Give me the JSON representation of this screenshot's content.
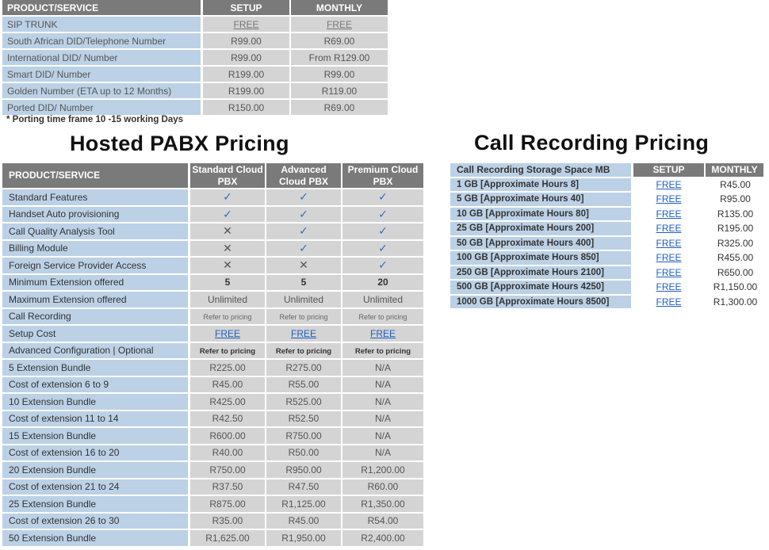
{
  "table1": {
    "headers": [
      "PRODUCT/SERVICE",
      "SETUP",
      "MONTHLY"
    ],
    "rows": [
      [
        "SIP TRUNK",
        "FREE",
        "FREE"
      ],
      [
        "South African DID/Telephone Number",
        "R99.00",
        "R69.00"
      ],
      [
        "International DID/ Number",
        "R99.00",
        "From R129.00"
      ],
      [
        "Smart DID/ Number",
        "R199.00",
        "R99.00"
      ],
      [
        "Golden Number (ETA up to 12 Months)",
        "R199.00",
        "R119.00"
      ],
      [
        "Ported DID/ Number",
        "R150.00",
        "R69.00"
      ]
    ],
    "note": "* Porting time frame 10 -15 working Days"
  },
  "pabx": {
    "title": "Hosted PABX Pricing",
    "headers": [
      "PRODUCT/SERVICE",
      "Standard Cloud PBX",
      "Advanced Cloud PBX",
      "Premium Cloud PBX"
    ],
    "rows": [
      [
        "Standard Features",
        "✓",
        "✓",
        "✓"
      ],
      [
        "Handset Auto provisioning",
        "✓",
        "✓",
        "✓"
      ],
      [
        "Call Quality Analysis Tool",
        "✕",
        "✓",
        "✓"
      ],
      [
        "Billing Module",
        "✕",
        "✓",
        "✓"
      ],
      [
        "Foreign Service Provider Access",
        "✕",
        "✕",
        "✓"
      ],
      [
        "Minimum Extension offered",
        "5",
        "5",
        "20"
      ],
      [
        "Maximum Extension offered",
        "Unlimited",
        "Unlimited",
        "Unlimited"
      ],
      [
        "Call Recording",
        "Refer to pricing",
        "Refer to pricing",
        "Refer to pricing"
      ],
      [
        "Setup Cost",
        "FREE",
        "FREE",
        "FREE"
      ],
      [
        "Advanced Configuration | Optional",
        "Refer to pricing",
        "Refer to pricing",
        "Refer to pricing"
      ],
      [
        "5 Extension Bundle",
        "R225.00",
        "R275.00",
        "N/A"
      ],
      [
        "Cost of extension 6 to 9",
        "R45.00",
        "R55.00",
        "N/A"
      ],
      [
        "10 Extension Bundle",
        "R425.00",
        "R525.00",
        "N/A"
      ],
      [
        "Cost of extension 11 to 14",
        "R42.50",
        "R52.50",
        "N/A"
      ],
      [
        "15 Extension Bundle",
        "R600.00",
        "R750.00",
        "N/A"
      ],
      [
        "Cost of extension 16 to 20",
        "R40.00",
        "R50.00",
        "N/A"
      ],
      [
        "20 Extension Bundle",
        "R750.00",
        "R950.00",
        "R1,200.00"
      ],
      [
        "Cost of extension 21 to 24",
        "R37.50",
        "R47.50",
        "R60.00"
      ],
      [
        "25 Extension Bundle",
        "R875.00",
        "R1,125.00",
        "R1,350.00"
      ],
      [
        "Cost of extension 26 to 30",
        "R35.00",
        "R45.00",
        "R54.00"
      ],
      [
        "50 Extension Bundle",
        "R1,625.00",
        "R1,950.00",
        "R2,400.00"
      ]
    ]
  },
  "recording": {
    "title": "Call Recording Pricing",
    "headers": [
      "Call Recording Storage Space MB",
      "SETUP",
      "MONTHLY"
    ],
    "rows": [
      [
        "1 GB [Approximate Hours 8]",
        "FREE",
        "R45.00"
      ],
      [
        "5 GB [Approximate Hours 40]",
        "FREE",
        "R95.00"
      ],
      [
        "10 GB [Approximate Hours 80]",
        "FREE",
        "R135.00"
      ],
      [
        "25 GB [Approximate Hours 200]",
        "FREE",
        "R195.00"
      ],
      [
        "50 GB [Approximate Hours 400]",
        "FREE",
        "R325.00"
      ],
      [
        "100 GB [Approximate Hours 850]",
        "FREE",
        "R455.00"
      ],
      [
        "250 GB [Approximate Hours 2100]",
        "FREE",
        "R650.00"
      ],
      [
        "500 GB [Approximate Hours 4250]",
        "FREE",
        "R1,150.00"
      ],
      [
        "1000 GB [Approximate Hours 8500]",
        "FREE",
        "R1,300.00"
      ]
    ]
  }
}
